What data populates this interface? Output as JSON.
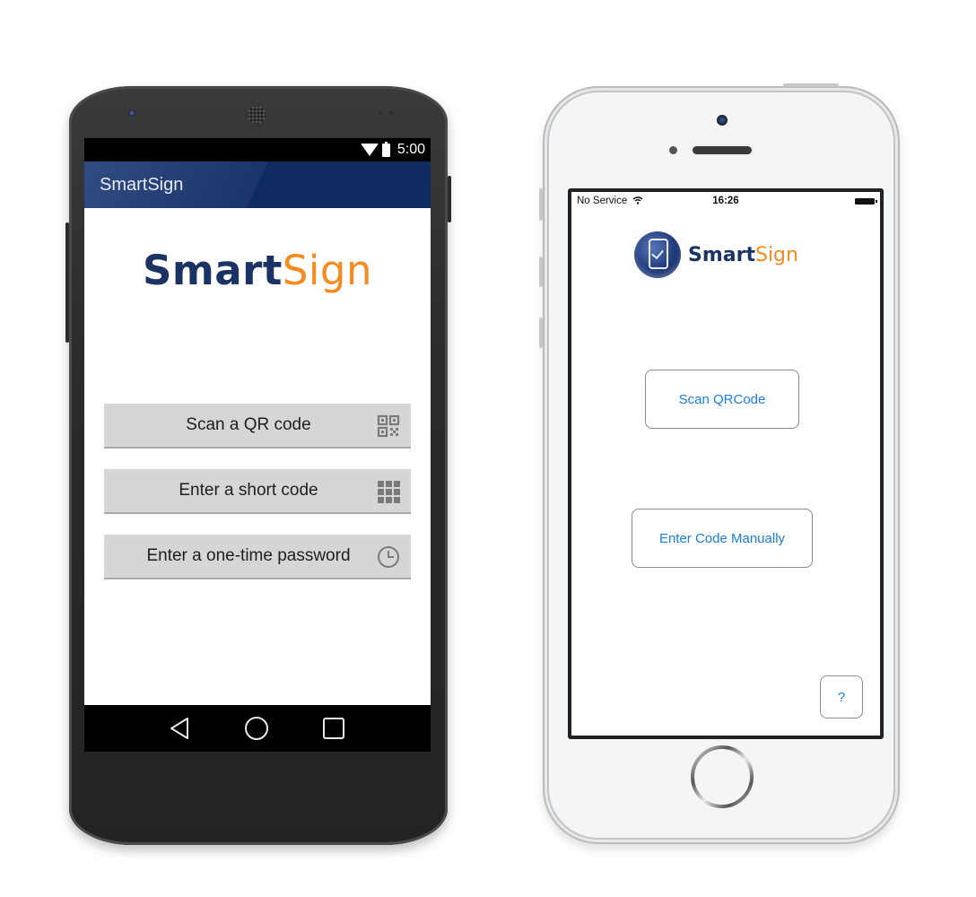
{
  "android": {
    "status_bar": {
      "time": "5:00",
      "icons": [
        "wifi-icon",
        "battery-icon"
      ]
    },
    "app_bar": {
      "title": "SmartSign"
    },
    "logo": {
      "part1": "Smart",
      "part2": "Sign"
    },
    "buttons": [
      {
        "label": "Scan a QR code",
        "icon": "qr-code-icon"
      },
      {
        "label": "Enter a short code",
        "icon": "keypad-grid-icon"
      },
      {
        "label": "Enter a one-time password",
        "icon": "clock-icon"
      }
    ],
    "nav_bar": [
      "back-icon",
      "home-icon",
      "recents-icon"
    ]
  },
  "iphone": {
    "status_bar": {
      "carrier": "No Service",
      "time": "16:26"
    },
    "logo": {
      "part1": "Smart",
      "part2": "Sign"
    },
    "buttons": [
      {
        "label": "Scan QRCode"
      },
      {
        "label": "Enter Code Manually"
      },
      {
        "label": "?"
      }
    ]
  },
  "colors": {
    "brand_navy": "#1b3264",
    "brand_orange": "#f58a1f",
    "ios_blue": "#1a7ee0",
    "android_appbar": "#0f2a60"
  }
}
